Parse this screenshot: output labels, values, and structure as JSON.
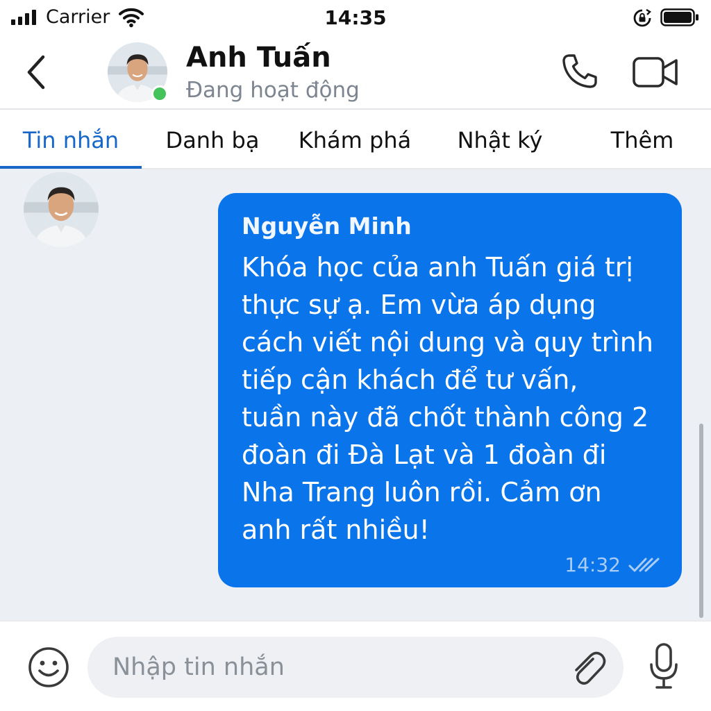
{
  "status_bar": {
    "carrier": "Carrier",
    "time": "14:35",
    "icons": [
      "signal-icon",
      "wifi-icon",
      "rotation-lock-icon",
      "battery-icon"
    ]
  },
  "header": {
    "contact_name": "Anh Tuấn",
    "contact_status": "Đang hoạt động",
    "presence": "online",
    "icons": [
      "back-icon",
      "phone-icon",
      "video-icon"
    ]
  },
  "tabs": [
    {
      "label": "Tin nhắn",
      "active": true
    },
    {
      "label": "Danh bạ",
      "active": false
    },
    {
      "label": "Khám phá",
      "active": false
    },
    {
      "label": "Nhật ký",
      "active": false
    },
    {
      "label": "Thêm",
      "active": false
    }
  ],
  "messages": [
    {
      "sender": "Nguyễn Minh",
      "text": "Khóa học của anh Tuấn giá trị\nthực sự ạ. Em vừa áp dụng\ncách viết nội dung và quy trình\ntiếp cận khách để tư vấn,\ntuần này đã chốt thành công 2\nđoàn đi Đà Lạt và 1 đoàn đi\nNha Trang luôn rồi. Cảm ơn\nanh rất nhiều!",
      "time": "14:32",
      "status_icon": "double-check-icon"
    }
  ],
  "composer": {
    "placeholder": "Nhập tin nhắn",
    "icons": [
      "emoji-icon",
      "paperclip-icon",
      "microphone-icon"
    ]
  },
  "colors": {
    "accent": "#1667c7",
    "bubble": "#0a74ea",
    "online": "#43c35a",
    "chat_background": "#ecf0f4"
  }
}
